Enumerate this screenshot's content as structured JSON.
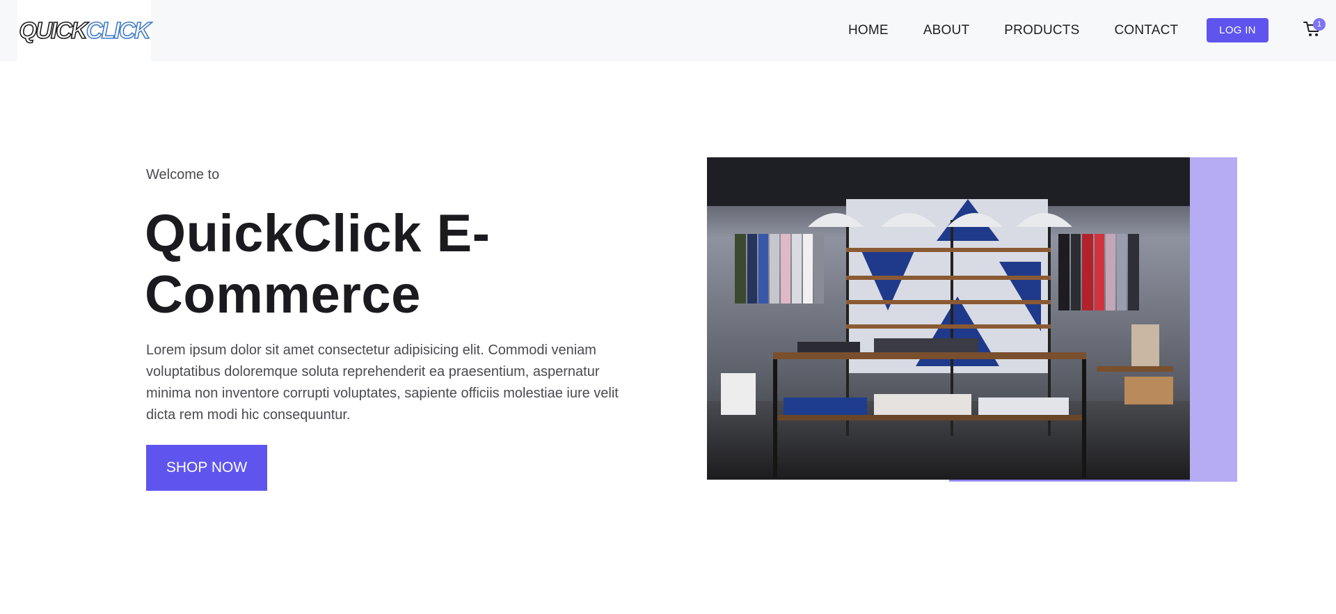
{
  "brand": {
    "logo_part1": "QUICK",
    "logo_part2": "CLICK"
  },
  "nav": {
    "links": [
      "HOME",
      "ABOUT",
      "PRODUCTS",
      "CONTACT"
    ],
    "login_label": "LOG IN",
    "cart_count": "1",
    "cart_icon": "cart-icon"
  },
  "hero": {
    "eyebrow": "Welcome to",
    "title": "QuickClick E-Commerce",
    "description": "Lorem ipsum dolor sit amet consectetur adipisicing elit. Commodi veniam voluptatibus doloremque soluta reprehenderit ea praesentium, aspernatur minima non inventore corrupti voluptates, sapiente officiis molestiae iure velit dicta rem modi hic consequuntur.",
    "cta_label": "SHOP NOW",
    "image_subject": "clothing-store-interior"
  },
  "colors": {
    "accent": "#5f55ee",
    "accent_light": "#b5acf4",
    "nav_bg": "#f7f8fa"
  }
}
